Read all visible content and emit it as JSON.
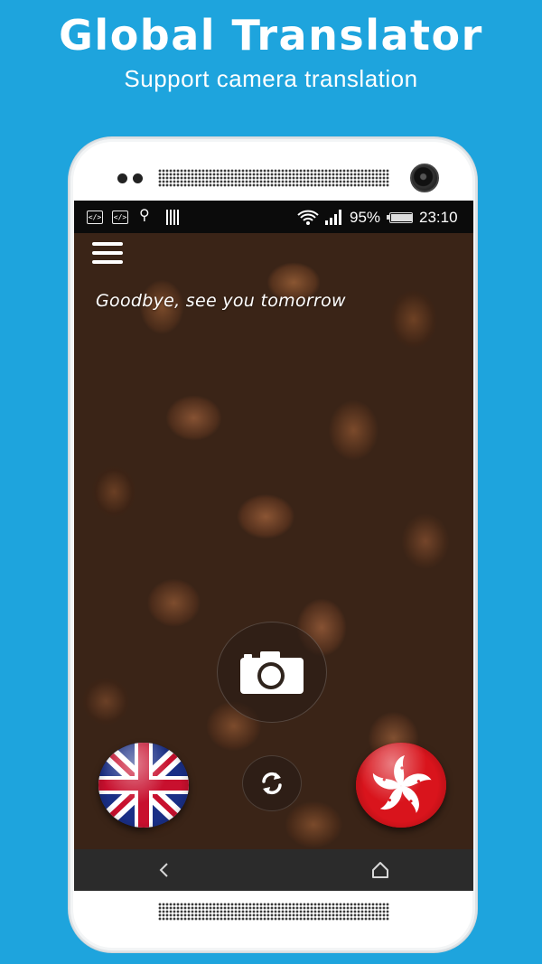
{
  "promo": {
    "title": "Global Translator",
    "subtitle": "Support camera translation"
  },
  "status_bar": {
    "left_icons": [
      "developer-icon",
      "developer-icon",
      "usb-icon",
      "storage-icon"
    ],
    "wifi": "wifi-icon",
    "signal": "signal-icon",
    "battery_percent": "95%",
    "battery_level": 0.95,
    "time": "23:10"
  },
  "app": {
    "menu_icon": "hamburger-menu-icon",
    "translated_text": "Goodbye, see you tomorrow",
    "capture_icon": "camera-icon",
    "swap_icon": "swap-languages-icon",
    "source_language_flag": "united-kingdom-flag",
    "target_language_flag": "hong-kong-flag"
  },
  "navigation": {
    "back_icon": "back-icon",
    "home_icon": "home-icon"
  },
  "colors": {
    "background": "#1ea4dd",
    "hk_red": "#d9141c",
    "uk_blue": "#1a2f86",
    "uk_red": "#c8102e"
  }
}
